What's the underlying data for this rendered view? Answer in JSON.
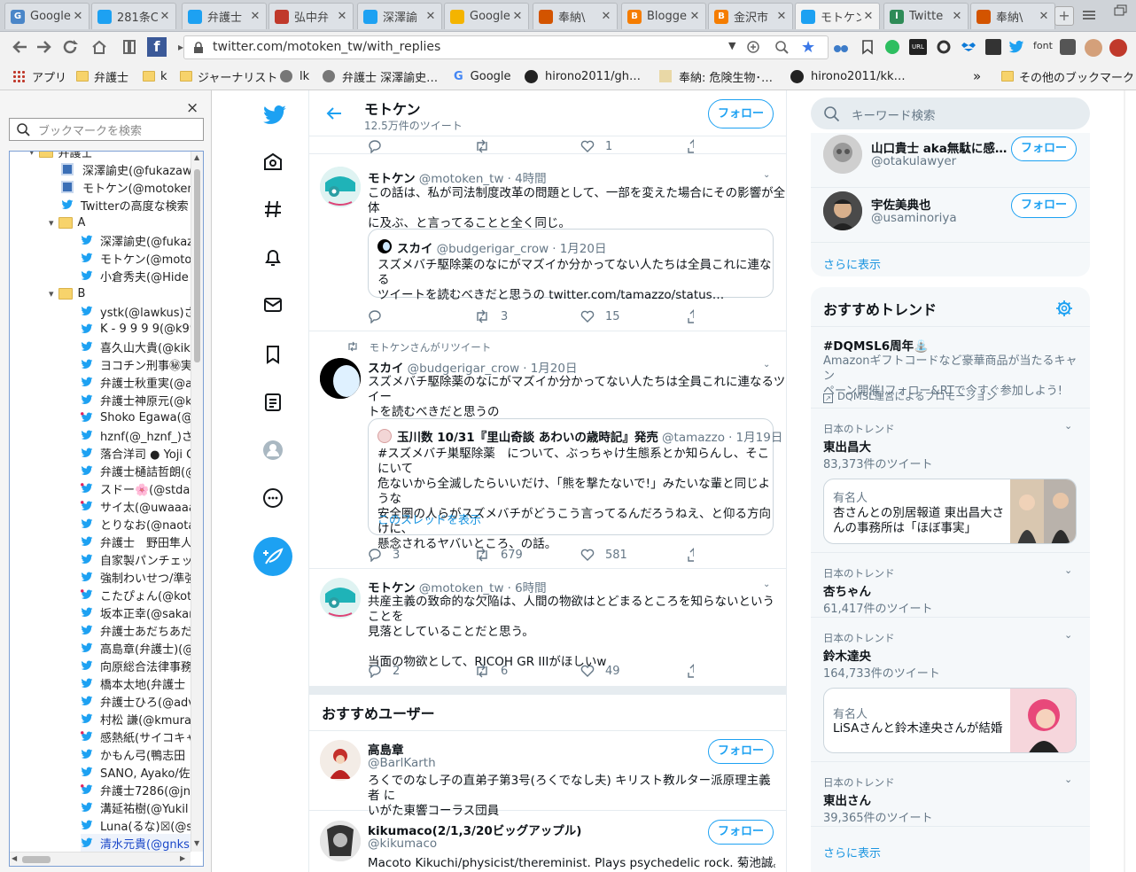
{
  "tabs": [
    {
      "title": "Google",
      "favicon_text": "G",
      "color": "#4a86c8"
    },
    {
      "title": "281条C",
      "favicon_text": "",
      "color": "#1da1f2"
    },
    {
      "title": "弁護士",
      "favicon_text": "",
      "color": "#1da1f2"
    },
    {
      "title": "弘中弁",
      "favicon_text": "",
      "color": "#c0392b"
    },
    {
      "title": "深澤諭",
      "favicon_text": "",
      "color": "#1da1f2"
    },
    {
      "title": "Google",
      "favicon_text": "",
      "color": "#f4b400"
    },
    {
      "title": "奉納\\",
      "favicon_text": "",
      "color": "#d35400"
    },
    {
      "title": "Blogge",
      "favicon_text": "B",
      "color": "#f57d00"
    },
    {
      "title": "金沢市",
      "favicon_text": "B",
      "color": "#f57d00"
    },
    {
      "title": "モトケン",
      "favicon_text": "",
      "color": "#1da1f2"
    },
    {
      "title": "Twitte",
      "favicon_text": "l",
      "color": "#2e8b57"
    },
    {
      "title": "奉納\\",
      "favicon_text": "",
      "color": "#d35400"
    }
  ],
  "url": "twitter.com/motoken_tw/with_replies",
  "bookmarks_bar": [
    {
      "label": "アプリ",
      "icon": "apps-icon"
    },
    {
      "label": "弁護士",
      "icon": "folder-icon"
    },
    {
      "label": "k",
      "icon": "folder-icon"
    },
    {
      "label": "ジャーナリスト",
      "icon": "folder-icon"
    },
    {
      "label": "lk",
      "icon": "globe-icon"
    },
    {
      "label": "弁護士 深澤諭史…",
      "icon": "globe-icon"
    },
    {
      "label": "Google",
      "icon": "google-icon"
    },
    {
      "label": "hirono2011/gh…",
      "icon": "github-icon"
    },
    {
      "label": "奉納: 危険生物･…",
      "icon": "page-icon"
    },
    {
      "label": "hirono2011/kk…",
      "icon": "github-icon"
    },
    {
      "label": "»",
      "icon": ""
    },
    {
      "label": "その他のブックマーク",
      "icon": "folder-icon"
    }
  ],
  "sidebar": {
    "search_placeholder": "ブックマークを検索",
    "close": "×",
    "items": [
      {
        "label": "弁護士",
        "type": "folder",
        "indent": 1
      },
      {
        "label": "深澤諭史(@fukazawa",
        "type": "t",
        "indent": 2
      },
      {
        "label": "モトケン(@motoken_",
        "type": "t",
        "indent": 2
      },
      {
        "label": "Twitterの高度な検索",
        "type": "bird",
        "indent": 2
      },
      {
        "label": "A",
        "type": "folder",
        "indent": 2
      },
      {
        "label": "深澤諭史(@fukaz",
        "type": "bird",
        "indent": 3
      },
      {
        "label": "モトケン(@motok",
        "type": "bird",
        "indent": 3
      },
      {
        "label": "小倉秀夫(@Hide",
        "type": "bird",
        "indent": 3
      },
      {
        "label": "B",
        "type": "folder",
        "indent": 2
      },
      {
        "label": "ystk(@lawkus)さん",
        "type": "bird",
        "indent": 3
      },
      {
        "label": "K - 9 9 9 9(@k99",
        "type": "bird",
        "indent": 3
      },
      {
        "label": "喜久山大貴(@kik",
        "type": "bird",
        "indent": 3
      },
      {
        "label": "ヨコチン刑事㊙実",
        "type": "bird",
        "indent": 3
      },
      {
        "label": "弁護士秋重実(@a",
        "type": "bird",
        "indent": 3
      },
      {
        "label": "弁護士神原元(@k",
        "type": "bird",
        "indent": 3
      },
      {
        "label": "Shoko Egawa(@",
        "type": "birdr",
        "indent": 3
      },
      {
        "label": "hznf(@_hznf_)さん",
        "type": "bird",
        "indent": 3
      },
      {
        "label": "落合洋司 ● Yoji O",
        "type": "bird",
        "indent": 3
      },
      {
        "label": "弁護士樋詰哲朗(@",
        "type": "bird",
        "indent": 3
      },
      {
        "label": "スドー🌸(@stdau",
        "type": "birdr",
        "indent": 3
      },
      {
        "label": "サイ太(@uwaaaa)",
        "type": "birdr",
        "indent": 3
      },
      {
        "label": "とりなお(@naotar",
        "type": "bird",
        "indent": 3
      },
      {
        "label": "弁護士　野田隼人",
        "type": "bird",
        "indent": 3
      },
      {
        "label": "自家製パンチェッタ",
        "type": "bird",
        "indent": 3
      },
      {
        "label": "強制わいせつ/準強",
        "type": "bird",
        "indent": 3
      },
      {
        "label": "こたぴょん(@kotar",
        "type": "birdr",
        "indent": 3
      },
      {
        "label": "坂本正幸(@sakan",
        "type": "bird",
        "indent": 3
      },
      {
        "label": "弁護士あだちあだち",
        "type": "bird",
        "indent": 3
      },
      {
        "label": "高島章(弁護士)(@",
        "type": "bird",
        "indent": 3
      },
      {
        "label": "向原総合法律事務",
        "type": "bird",
        "indent": 3
      },
      {
        "label": "橋本太地(弁護士",
        "type": "bird",
        "indent": 3
      },
      {
        "label": "弁護士ひろ(@adv",
        "type": "bird",
        "indent": 3
      },
      {
        "label": "村松 謙(@kmurar",
        "type": "bird",
        "indent": 3
      },
      {
        "label": "感熱紙(サイコキャ",
        "type": "birdr",
        "indent": 3
      },
      {
        "label": "かもん弓(鴨志田",
        "type": "bird",
        "indent": 3
      },
      {
        "label": "SANO, Ayako/佐",
        "type": "bird",
        "indent": 3
      },
      {
        "label": "弁護士7286(@jn",
        "type": "birdr",
        "indent": 3
      },
      {
        "label": "溝延祐樹(@Yukil",
        "type": "bird",
        "indent": 3
      },
      {
        "label": "Luna(るな)☒(@st",
        "type": "bird",
        "indent": 3
      },
      {
        "label": "清水元貴(@gnks",
        "type": "bird",
        "indent": 3,
        "selected": true
      }
    ]
  },
  "header": {
    "name": "モトケン",
    "tweet_count": "12.5万件のツイート",
    "follow": "フォロー"
  },
  "tweets": {
    "t0": {
      "reply": "",
      "rt": "",
      "like": "1"
    },
    "t1": {
      "name": "モトケン",
      "handle": "@motoken_tw",
      "time": "4時間",
      "line1": "この話は、私が司法制度改革の問題として、一部を変えた場合にその影響が全体",
      "line2": "に及ぶ、と言ってることと全く同じ。",
      "q_name": "スカイ",
      "q_handle": "@budgerigar_crow",
      "q_time": "1月20日",
      "q_line1": "スズメバチ駆除薬のなにがマズイか分かってない人たちは全員これに連なる",
      "q_line2": "ツイートを読むべきだと思うの twitter.com/tamazzo/status…",
      "reply": "",
      "rt": "3",
      "like": "15"
    },
    "t2": {
      "rt_label": "モトケンさんがリツイート",
      "name": "スカイ",
      "handle": "@budgerigar_crow",
      "time": "1月20日",
      "line1": "スズメバチ駆除薬のなにがマズイか分かってない人たちは全員これに連なるツイー",
      "line2": "トを読むべきだと思うの",
      "q_name": "玉川数 10/31『里山奇談 あわいの歳時記』発売",
      "q_handle": "@tamazzo",
      "q_time": "1月19日",
      "q_line1": "#スズメバチ巣駆除薬　について、ぶっちゃけ生態系とか知らんし、そこにいて",
      "q_line2": "危ないから全滅したらいいだけ、「熊を撃たないで!」みたいな輩と同じような",
      "q_line3": "安全圏の人らがスズメバチがどうこう言ってるんだろうねえ、と仰る方向けに、",
      "q_line4": "懸念されるヤバいところ、の話。",
      "q_thread": "このスレッドを表示",
      "reply": "3",
      "rt": "679",
      "like": "581"
    },
    "t3": {
      "name": "モトケン",
      "handle": "@motoken_tw",
      "time": "6時間",
      "line1": "共産主義の致命的な欠陥は、人間の物欲はとどまるところを知らないということを",
      "line2": "見落としていることだと思う。",
      "line3": "当面の物欲として、RICOH GR IIIがほしいw",
      "reply": "2",
      "rt": "6",
      "like": "49"
    }
  },
  "recommended": {
    "title": "おすすめユーザー",
    "users": [
      {
        "name": "高島章",
        "handle": "@BarlKarth",
        "bio1": "ろくでのなし子の直弟子第3号(ろくでなし夫) キリスト教ルター派原理主義者 に",
        "bio2": "いがた東響コーラス団員",
        "follow": "フォロー"
      },
      {
        "name": "kikumaco(2/1,3/20ビッグアップル)",
        "handle": "@kikumaco",
        "bio1": "Macoto Kikuchi/physicist/thereminist. Plays psychedelic rock. 菊池誠。物理学",
        "bio2": "",
        "follow": "フォロー"
      }
    ]
  },
  "right": {
    "search_placeholder": "キーワード検索",
    "who_to_follow": [
      {
        "name": "山口貴士 aka無駄に感…",
        "handle": "@otakulawyer",
        "follow": "フォロー"
      },
      {
        "name": "宇佐美典也",
        "handle": "@usaminoriya",
        "follow": "フォロー"
      }
    ],
    "show_more": "さらに表示",
    "trends_title": "おすすめトレンド",
    "promo": {
      "tag": "#DQMSL6周年⛲",
      "line1": "Amazonギフトコードなど豪華商品が当たるキャン",
      "line2": "ペーン開催!フォロー&RTで今すぐ参加しよう!",
      "by": "DQMSL運営によるプロモーション"
    },
    "trends": [
      {
        "ctx": "日本のトレンド",
        "name": "東出昌大",
        "count": "83,373件のツイート"
      },
      {
        "ctx": "日本のトレンド",
        "name": "杏ちゃん",
        "count": "61,417件のツイート"
      },
      {
        "ctx": "日本のトレンド",
        "name": "鈴木達央",
        "count": "164,733件のツイート"
      },
      {
        "ctx": "日本のトレンド",
        "name": "東出さん",
        "count": "39,365件のツイート"
      }
    ],
    "card1": {
      "cat": "有名人",
      "line1": "杏さんとの別居報道 東出昌大さ",
      "line2": "んの事務所は「ほぼ事実」"
    },
    "card2": {
      "cat": "有名人",
      "line1": "LiSAさんと鈴木達央さんが結婚"
    },
    "show_more2": "さらに表示"
  },
  "colors": {
    "twitter_blue": "#1da1f2",
    "text_gray": "#657786",
    "border": "#e6ecf0"
  }
}
